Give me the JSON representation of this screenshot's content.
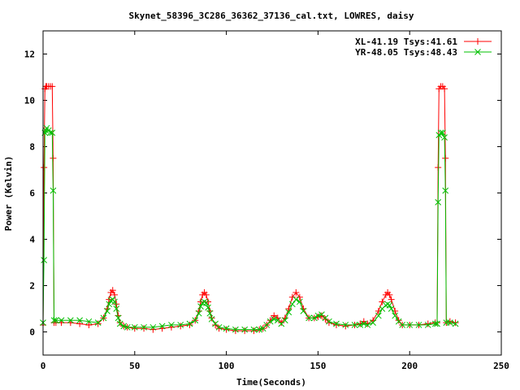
{
  "chart_data": {
    "type": "line",
    "title": "Skynet_58396_3C286_36362_37136_cal.txt, LOWRES, daisy",
    "xlabel": "Time(Seconds)",
    "ylabel": "Power (Kelvin)",
    "xlim": [
      0,
      250
    ],
    "ylim": [
      -1,
      13
    ],
    "xticks": [
      0,
      50,
      100,
      150,
      200,
      250
    ],
    "yticks": [
      0,
      2,
      4,
      6,
      8,
      10,
      12
    ],
    "grid": false,
    "legend_position": "top-right",
    "series": [
      {
        "name": "XL-41.19 Tsys:41.61",
        "color": "#ff0000",
        "marker": "plus",
        "x": [
          0,
          0.5,
          1,
          1.5,
          2,
          3,
          4,
          5,
          5.5,
          6,
          7,
          10,
          15,
          20,
          25,
          30,
          33,
          35,
          36,
          37,
          38,
          39,
          40,
          41,
          42,
          44,
          46,
          50,
          55,
          60,
          65,
          70,
          75,
          80,
          83,
          85,
          86,
          87,
          88,
          89,
          90,
          91,
          92,
          94,
          96,
          100,
          105,
          110,
          115,
          118,
          120,
          122,
          124,
          126,
          128,
          130,
          132,
          134,
          136,
          138,
          140,
          142,
          145,
          148,
          150,
          152,
          154,
          156,
          160,
          165,
          170,
          173,
          175,
          177,
          180,
          183,
          185,
          187,
          188,
          189,
          190,
          192,
          194,
          196,
          200,
          205,
          210,
          214,
          215,
          215.5,
          216,
          217,
          218,
          219,
          219.5,
          220,
          222,
          225
        ],
        "y": [
          0.3,
          7.1,
          10.5,
          10.6,
          10.6,
          10.6,
          10.6,
          10.6,
          7.5,
          0.4,
          0.4,
          0.4,
          0.4,
          0.35,
          0.3,
          0.35,
          0.6,
          1.0,
          1.4,
          1.7,
          1.8,
          1.6,
          1.2,
          0.7,
          0.4,
          0.25,
          0.2,
          0.15,
          0.15,
          0.1,
          0.15,
          0.2,
          0.25,
          0.3,
          0.5,
          0.9,
          1.3,
          1.6,
          1.7,
          1.6,
          1.3,
          0.9,
          0.6,
          0.3,
          0.15,
          0.1,
          0.05,
          0.05,
          0.05,
          0.1,
          0.15,
          0.3,
          0.5,
          0.7,
          0.6,
          0.4,
          0.6,
          1.0,
          1.5,
          1.7,
          1.5,
          1.0,
          0.6,
          0.6,
          0.65,
          0.7,
          0.55,
          0.4,
          0.3,
          0.25,
          0.3,
          0.35,
          0.45,
          0.35,
          0.5,
          0.9,
          1.3,
          1.6,
          1.7,
          1.6,
          1.4,
          0.9,
          0.5,
          0.3,
          0.3,
          0.3,
          0.35,
          0.4,
          0.4,
          7.1,
          10.5,
          10.6,
          10.6,
          10.5,
          7.5,
          0.4,
          0.45,
          0.4
        ]
      },
      {
        "name": "YR-48.05 Tsys:48.43",
        "color": "#00c000",
        "marker": "cross",
        "x": [
          0,
          0.5,
          1,
          1.5,
          2,
          3,
          4,
          5,
          5.5,
          6,
          7,
          10,
          15,
          20,
          25,
          30,
          33,
          35,
          36,
          37,
          38,
          39,
          40,
          41,
          42,
          44,
          46,
          50,
          55,
          60,
          65,
          70,
          75,
          80,
          83,
          85,
          86,
          87,
          88,
          89,
          90,
          91,
          92,
          94,
          96,
          100,
          105,
          110,
          115,
          118,
          120,
          122,
          124,
          126,
          128,
          130,
          132,
          134,
          136,
          138,
          140,
          142,
          145,
          148,
          150,
          152,
          154,
          156,
          160,
          165,
          170,
          173,
          175,
          177,
          180,
          183,
          185,
          187,
          188,
          189,
          190,
          192,
          194,
          196,
          200,
          205,
          210,
          214,
          215,
          215.5,
          216,
          217,
          218,
          219,
          219.5,
          220,
          222,
          225
        ],
        "y": [
          0.4,
          3.1,
          8.6,
          8.7,
          8.8,
          8.7,
          8.6,
          8.6,
          6.1,
          0.5,
          0.5,
          0.5,
          0.5,
          0.5,
          0.45,
          0.4,
          0.6,
          0.9,
          1.2,
          1.35,
          1.4,
          1.3,
          1.0,
          0.6,
          0.35,
          0.25,
          0.2,
          0.2,
          0.2,
          0.2,
          0.25,
          0.3,
          0.3,
          0.35,
          0.5,
          0.8,
          1.1,
          1.25,
          1.3,
          1.25,
          1.05,
          0.8,
          0.55,
          0.35,
          0.2,
          0.15,
          0.1,
          0.1,
          0.1,
          0.1,
          0.15,
          0.3,
          0.45,
          0.55,
          0.5,
          0.35,
          0.5,
          0.85,
          1.2,
          1.4,
          1.3,
          0.9,
          0.6,
          0.6,
          0.7,
          0.75,
          0.6,
          0.45,
          0.35,
          0.3,
          0.3,
          0.3,
          0.35,
          0.3,
          0.4,
          0.7,
          1.0,
          1.15,
          1.2,
          1.15,
          1.0,
          0.7,
          0.45,
          0.3,
          0.3,
          0.3,
          0.3,
          0.35,
          0.35,
          5.6,
          8.5,
          8.6,
          8.6,
          8.4,
          6.1,
          0.4,
          0.4,
          0.35
        ]
      }
    ]
  }
}
